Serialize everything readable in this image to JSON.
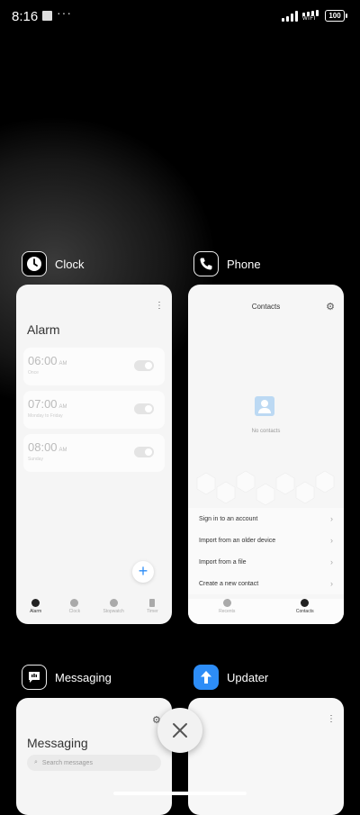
{
  "status_bar": {
    "time": "8:16",
    "dots": "···",
    "wifi_label": "WIFI",
    "battery": "100"
  },
  "apps": {
    "clock": {
      "name": "Clock",
      "icon": "clock-icon",
      "screen": {
        "title": "Alarm",
        "alarms": [
          {
            "time": "06:00",
            "ampm": "AM",
            "sub": "Once",
            "enabled": false
          },
          {
            "time": "07:00",
            "ampm": "AM",
            "sub": "Monday to Friday",
            "enabled": false
          },
          {
            "time": "08:00",
            "ampm": "AM",
            "sub": "Sunday",
            "enabled": false
          }
        ],
        "nav": [
          "Alarm",
          "Clock",
          "Stopwatch",
          "Timer"
        ]
      }
    },
    "phone": {
      "name": "Phone",
      "icon": "phone-icon",
      "screen": {
        "title": "Contacts",
        "empty_text": "No contacts",
        "menu": [
          "Sign in to an account",
          "Import from an older device",
          "Import from a file",
          "Create a new contact"
        ],
        "nav": [
          "Recents",
          "Contacts"
        ]
      }
    },
    "messaging": {
      "name": "Messaging",
      "icon": "message-icon",
      "screen": {
        "title": "Messaging",
        "search_placeholder": "Search messages"
      }
    },
    "updater": {
      "name": "Updater",
      "icon": "arrow-up-icon"
    }
  },
  "colors": {
    "accent": "#2d8df7",
    "updater_icon": "#2d8df7"
  }
}
